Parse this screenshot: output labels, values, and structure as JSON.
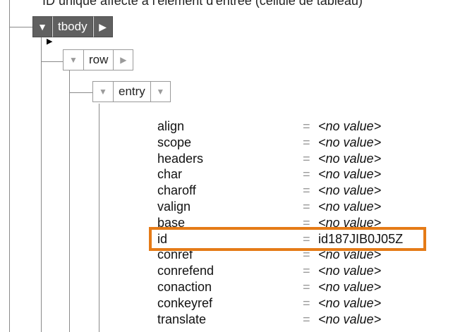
{
  "caption": "ID unique affecté à l'élément d'entrée (cellule de tableau)",
  "tree": {
    "tbody": {
      "label": "tbody",
      "expand_glyph": "▼",
      "next_glyph": "▶"
    },
    "row": {
      "label": "row",
      "expand_glyph": "▼",
      "next_glyph": "▶"
    },
    "entry": {
      "label": "entry",
      "expand_glyph": "▼",
      "next_glyph": "▼"
    },
    "marker_glyph": "▶"
  },
  "attributes": [
    {
      "name": "align",
      "value": "<no value>",
      "empty": true
    },
    {
      "name": "scope",
      "value": "<no value>",
      "empty": true
    },
    {
      "name": "headers",
      "value": "<no value>",
      "empty": true
    },
    {
      "name": "char",
      "value": "<no value>",
      "empty": true
    },
    {
      "name": "charoff",
      "value": "<no value>",
      "empty": true
    },
    {
      "name": "valign",
      "value": "<no value>",
      "empty": true
    },
    {
      "name": "base",
      "value": "<no value>",
      "empty": true
    },
    {
      "name": "id",
      "value": "id187JIB0J05Z",
      "empty": false,
      "highlighted": true
    },
    {
      "name": "conref",
      "value": "<no value>",
      "empty": true
    },
    {
      "name": "conrefend",
      "value": "<no value>",
      "empty": true
    },
    {
      "name": "conaction",
      "value": "<no value>",
      "empty": true
    },
    {
      "name": "conkeyref",
      "value": "<no value>",
      "empty": true
    },
    {
      "name": "translate",
      "value": "<no value>",
      "empty": true
    }
  ],
  "equals_sign": "=",
  "highlight_color": "#e57b17"
}
